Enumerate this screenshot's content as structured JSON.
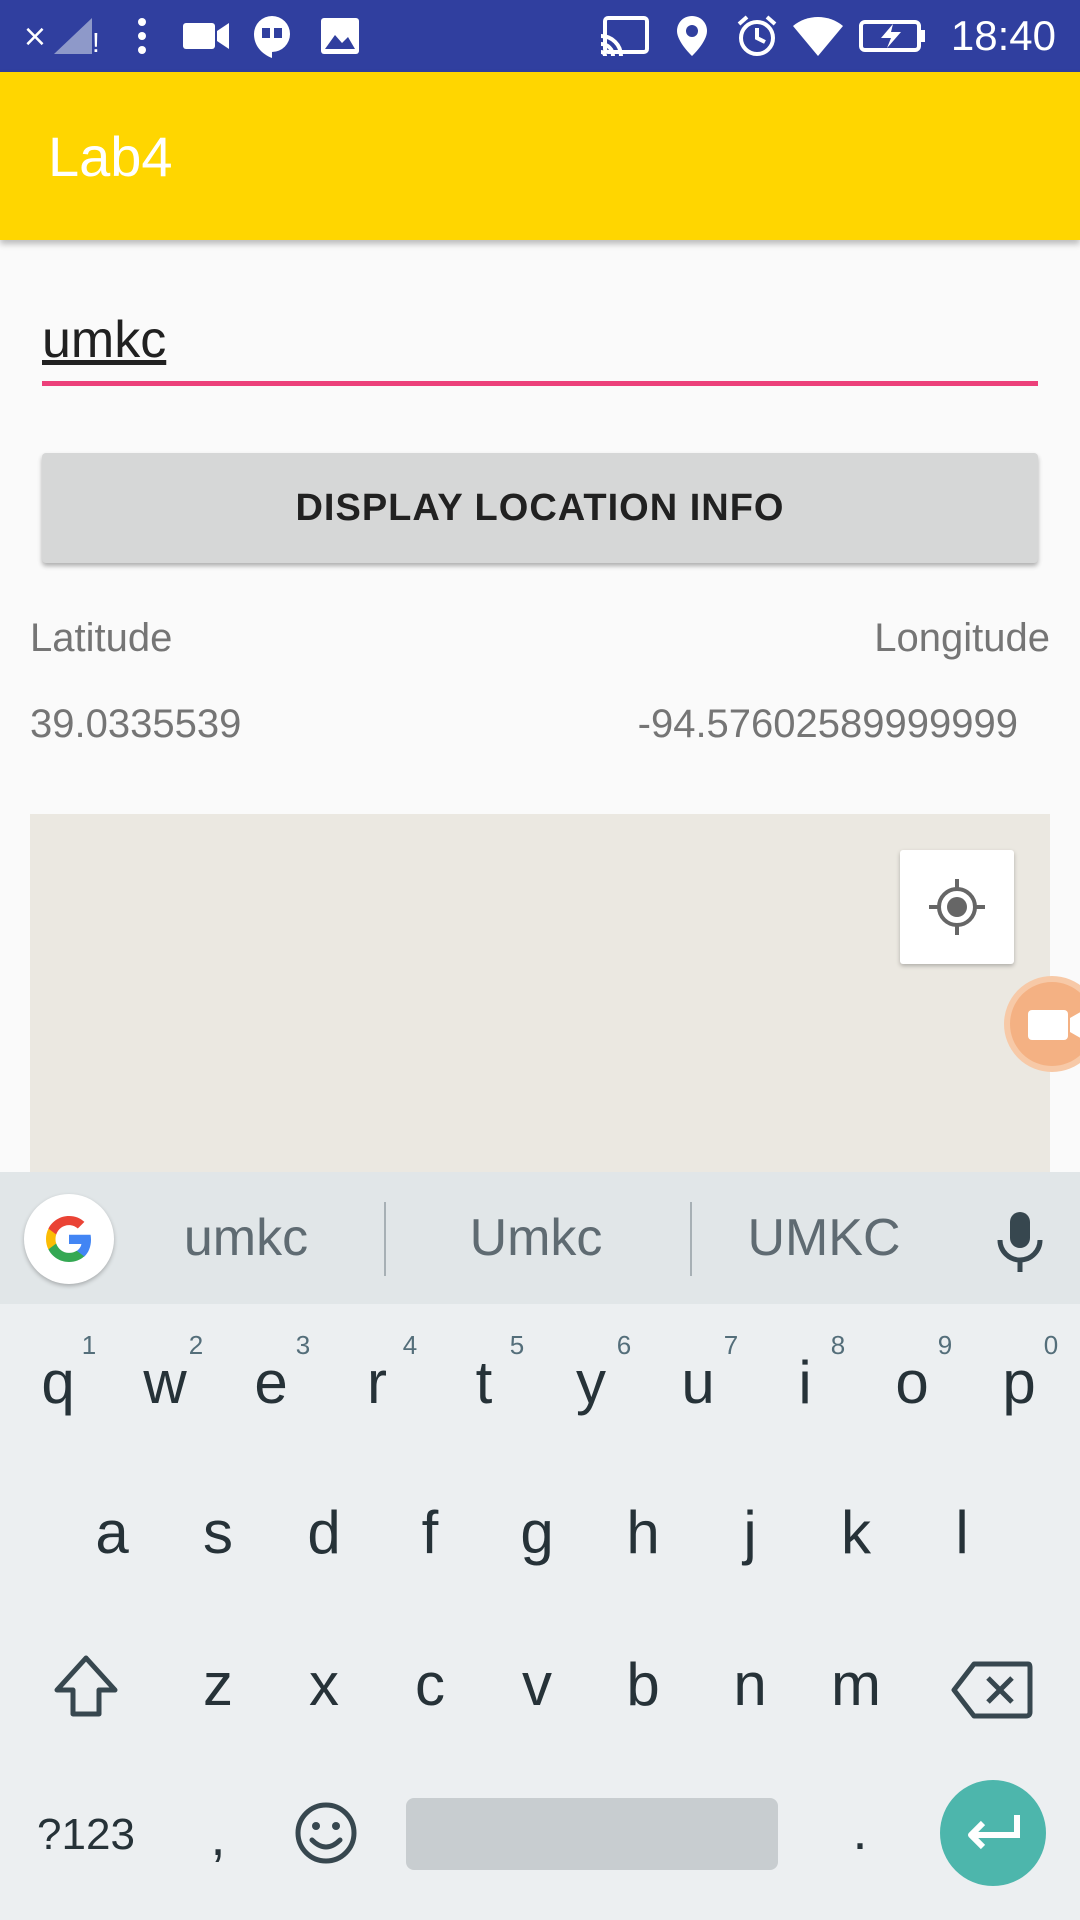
{
  "status_bar": {
    "time": "18:40",
    "icons": [
      "close-icon",
      "signal-icon",
      "more-vert-icon",
      "video-icon",
      "hangouts-icon",
      "image-icon",
      "cast-icon",
      "location-icon",
      "alarm-icon",
      "wifi-icon",
      "battery-charging-icon"
    ]
  },
  "app_bar": {
    "title": "Lab4"
  },
  "search": {
    "value": "umkc"
  },
  "display_button": {
    "label": "DISPLAY LOCATION INFO"
  },
  "location": {
    "latitude_label": "Latitude",
    "longitude_label": "Longitude",
    "latitude_value": "39.0335539",
    "longitude_value": "-94.57602589999999"
  },
  "map": {
    "my_location_icon": "my-location-icon",
    "record_icon": "video-record-icon"
  },
  "keyboard": {
    "suggestions": [
      "umkc",
      "Umkc",
      "UMKC"
    ],
    "row1": [
      {
        "k": "q",
        "h": "1"
      },
      {
        "k": "w",
        "h": "2"
      },
      {
        "k": "e",
        "h": "3"
      },
      {
        "k": "r",
        "h": "4"
      },
      {
        "k": "t",
        "h": "5"
      },
      {
        "k": "y",
        "h": "6"
      },
      {
        "k": "u",
        "h": "7"
      },
      {
        "k": "i",
        "h": "8"
      },
      {
        "k": "o",
        "h": "9"
      },
      {
        "k": "p",
        "h": "0"
      }
    ],
    "row2": [
      "a",
      "s",
      "d",
      "f",
      "g",
      "h",
      "j",
      "k",
      "l"
    ],
    "row3": [
      "z",
      "x",
      "c",
      "v",
      "b",
      "n",
      "m"
    ],
    "symbols_key": "?123",
    "comma_key": ",",
    "period_key": ".",
    "accent_color": "#4db6ac"
  },
  "colors": {
    "status_bar": "#303f9f",
    "app_bar": "#ffd600",
    "input_underline": "#ec407a"
  }
}
